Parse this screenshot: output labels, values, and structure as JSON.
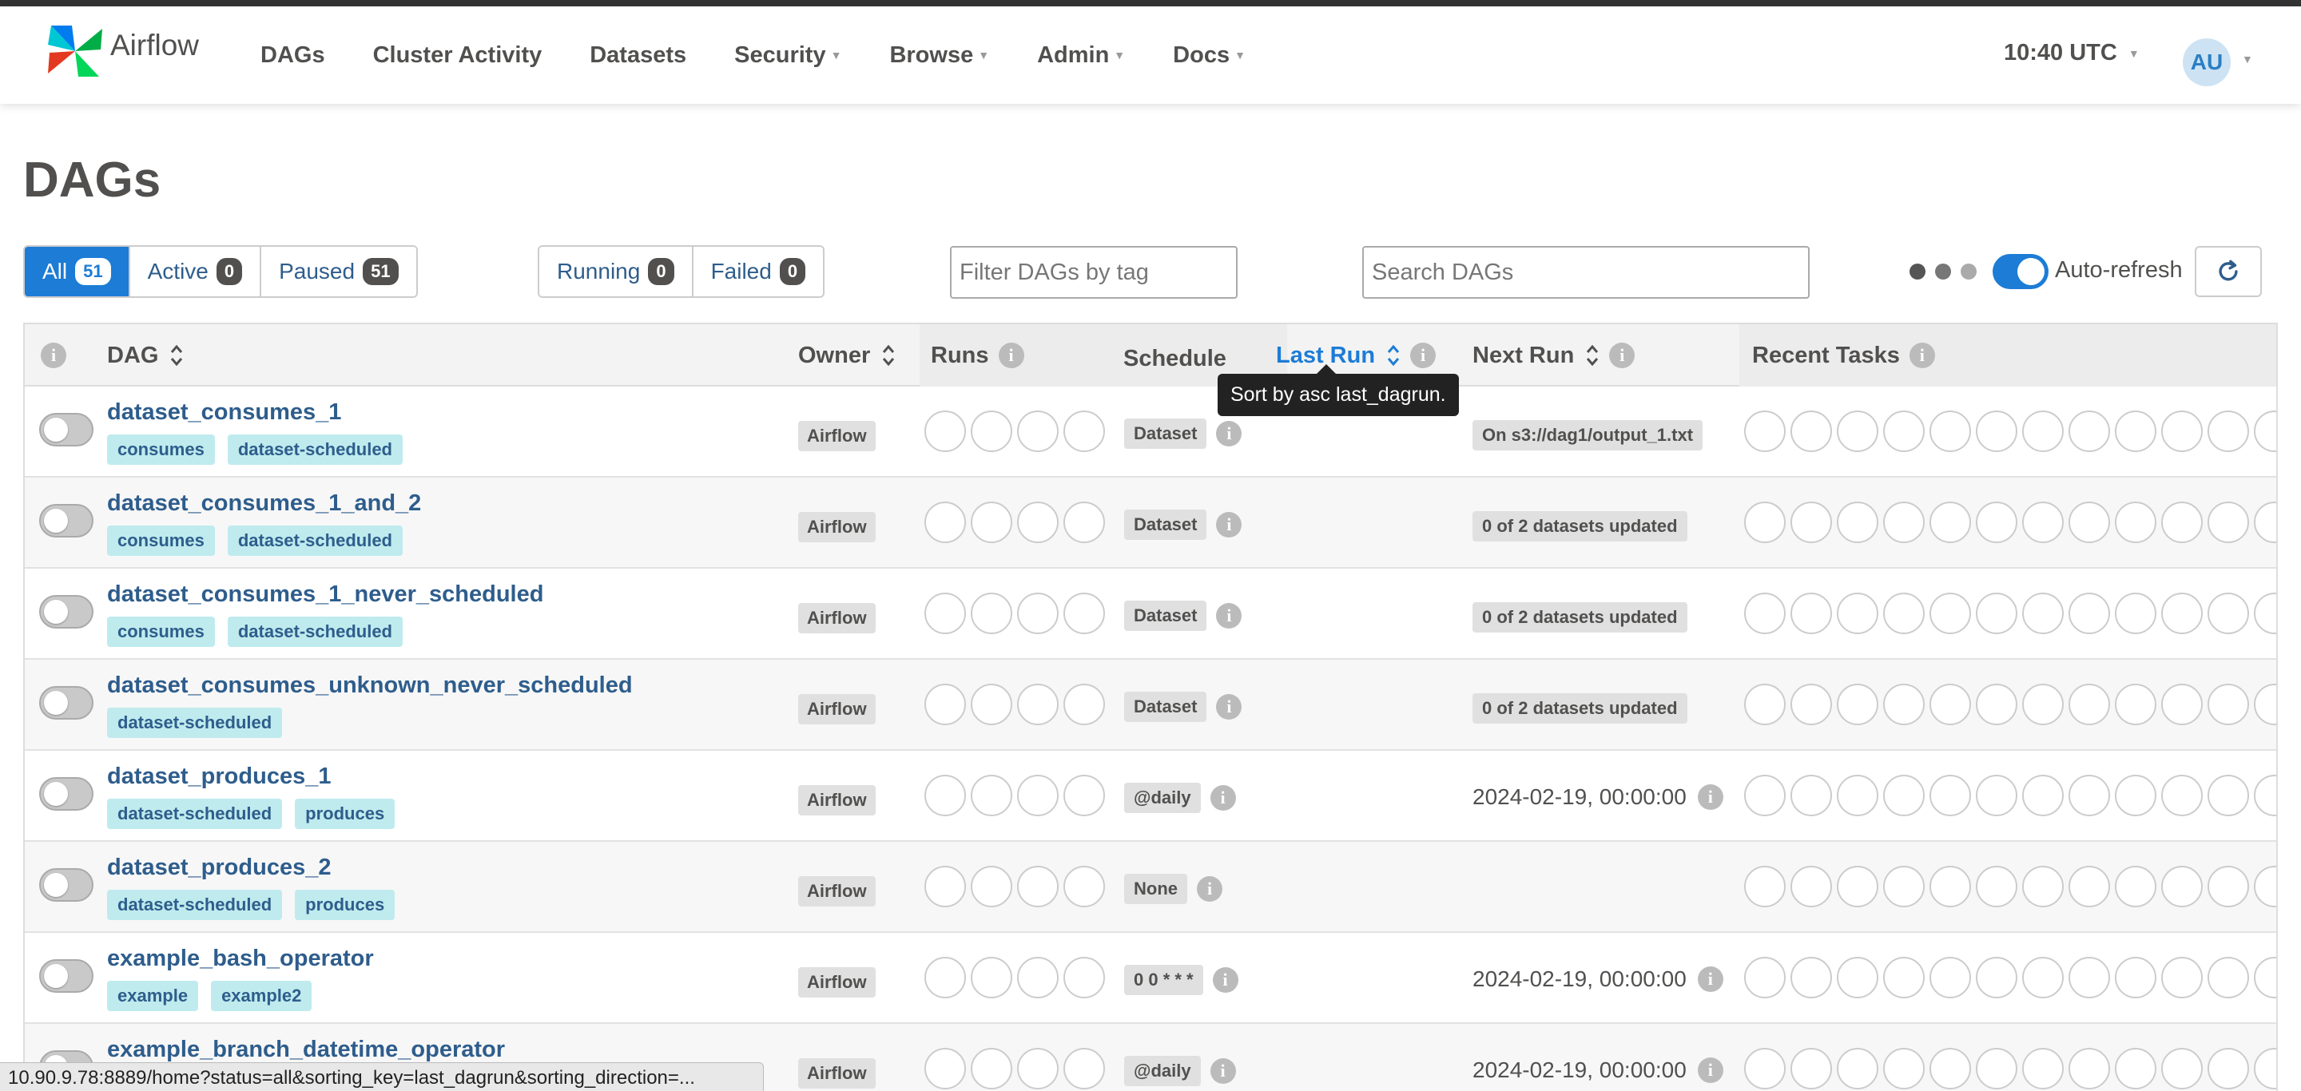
{
  "app": {
    "name": "Airflow"
  },
  "nav": {
    "items": [
      {
        "label": "DAGs",
        "dropdown": false
      },
      {
        "label": "Cluster Activity",
        "dropdown": false
      },
      {
        "label": "Datasets",
        "dropdown": false
      },
      {
        "label": "Security",
        "dropdown": true
      },
      {
        "label": "Browse",
        "dropdown": true
      },
      {
        "label": "Admin",
        "dropdown": true
      },
      {
        "label": "Docs",
        "dropdown": true
      }
    ],
    "clock": "10:40 UTC",
    "avatar": "AU"
  },
  "page": {
    "title": "DAGs"
  },
  "filters": {
    "all": {
      "label": "All",
      "count": "51"
    },
    "active": {
      "label": "Active",
      "count": "0"
    },
    "paused": {
      "label": "Paused",
      "count": "51"
    },
    "running": {
      "label": "Running",
      "count": "0"
    },
    "failed": {
      "label": "Failed",
      "count": "0"
    },
    "tag_placeholder": "Filter DAGs by tag",
    "search_placeholder": "Search DAGs",
    "auto_refresh_label": "Auto-refresh"
  },
  "colors": {
    "accent": "#1c7cd6",
    "tag_bg": "#bfebee",
    "link": "#2e5d8c"
  },
  "table": {
    "headers": {
      "dag": "DAG",
      "owner": "Owner",
      "runs": "Runs",
      "schedule": "Schedule",
      "last_run": "Last Run",
      "next_run": "Next Run",
      "recent_tasks": "Recent Tasks"
    },
    "tooltip": "Sort by asc last_dagrun.",
    "rows": [
      {
        "name": "dataset_consumes_1",
        "tags": [
          "consumes",
          "dataset-scheduled"
        ],
        "owner": "Airflow",
        "schedule": "Dataset",
        "next_run": "On s3://dag1/output_1.txt",
        "next_run_badge": true
      },
      {
        "name": "dataset_consumes_1_and_2",
        "tags": [
          "consumes",
          "dataset-scheduled"
        ],
        "owner": "Airflow",
        "schedule": "Dataset",
        "next_run": "0 of 2 datasets updated",
        "next_run_badge": true
      },
      {
        "name": "dataset_consumes_1_never_scheduled",
        "tags": [
          "consumes",
          "dataset-scheduled"
        ],
        "owner": "Airflow",
        "schedule": "Dataset",
        "next_run": "0 of 2 datasets updated",
        "next_run_badge": true
      },
      {
        "name": "dataset_consumes_unknown_never_scheduled",
        "tags": [
          "dataset-scheduled"
        ],
        "owner": "Airflow",
        "schedule": "Dataset",
        "next_run": "0 of 2 datasets updated",
        "next_run_badge": true
      },
      {
        "name": "dataset_produces_1",
        "tags": [
          "dataset-scheduled",
          "produces"
        ],
        "owner": "Airflow",
        "schedule": "@daily",
        "next_run": "2024-02-19, 00:00:00",
        "next_run_badge": false
      },
      {
        "name": "dataset_produces_2",
        "tags": [
          "dataset-scheduled",
          "produces"
        ],
        "owner": "Airflow",
        "schedule": "None",
        "next_run": "",
        "next_run_badge": false
      },
      {
        "name": "example_bash_operator",
        "tags": [
          "example",
          "example2"
        ],
        "owner": "Airflow",
        "schedule": "0 0 * * *",
        "next_run": "2024-02-19, 00:00:00",
        "next_run_badge": false
      },
      {
        "name": "example_branch_datetime_operator",
        "tags": [],
        "owner": "Airflow",
        "schedule": "@daily",
        "next_run": "2024-02-19, 00:00:00",
        "next_run_badge": false
      }
    ]
  },
  "status_bar": "10.90.9.78:8889/home?status=all&sorting_key=last_dagrun&sorting_direction=..."
}
